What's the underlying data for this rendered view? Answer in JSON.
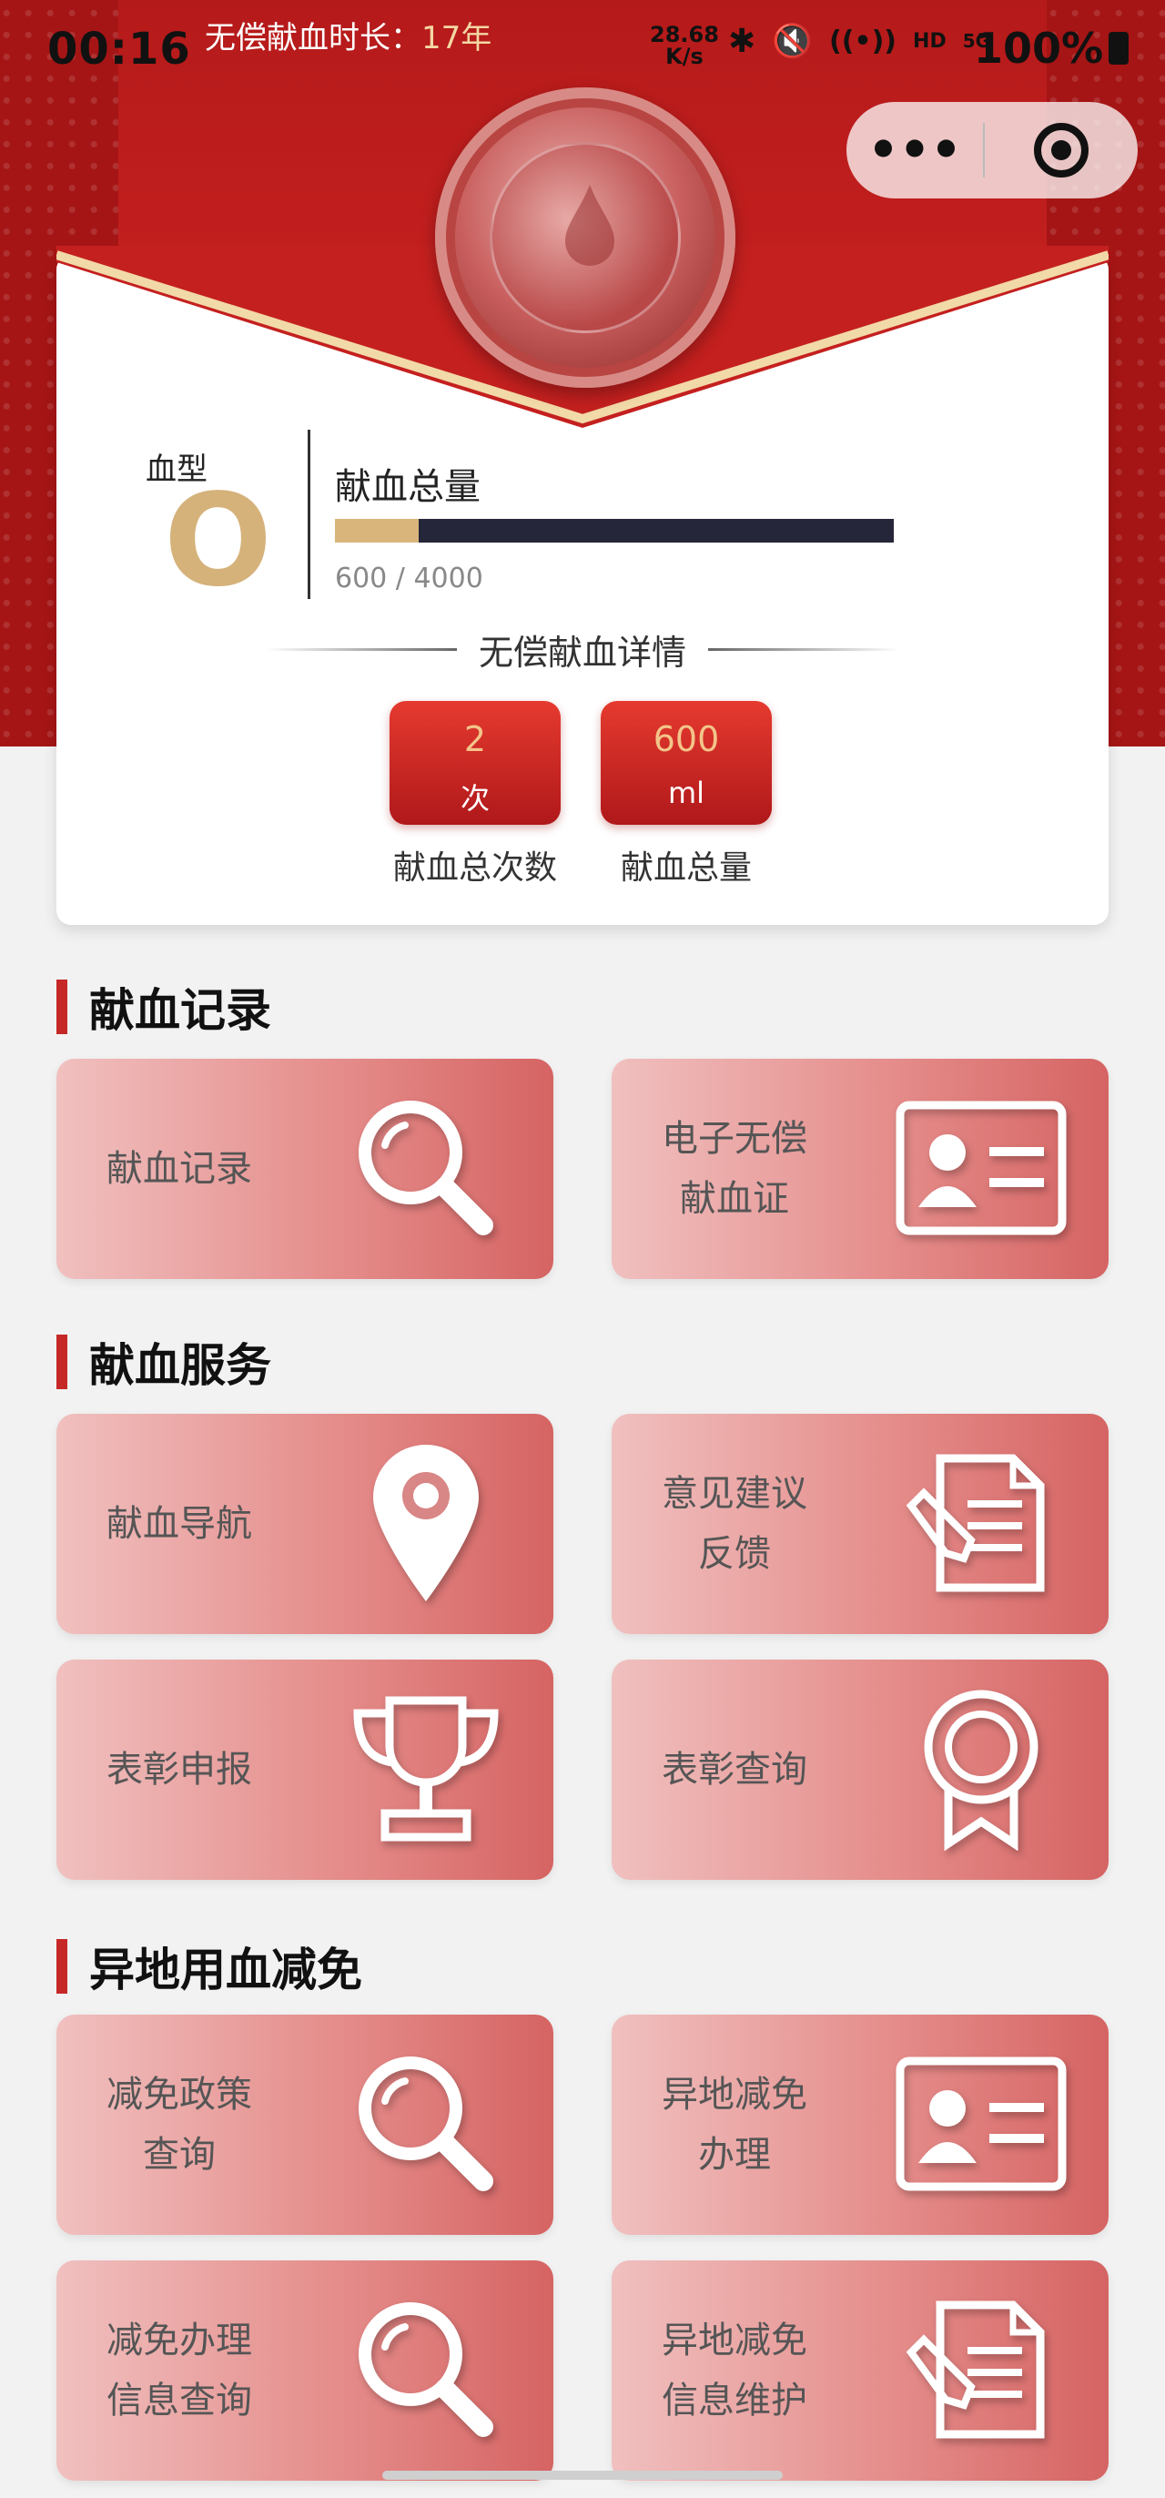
{
  "status_bar": {
    "time": "00:16",
    "notification_prefix": "无偿献血时长：",
    "notification_value": "17年",
    "net_speed_value": "28.68",
    "net_speed_unit": "K/s",
    "network": "HD",
    "signal": "5G",
    "battery": "100%"
  },
  "capsule": {
    "more_label": "•••"
  },
  "profile": {
    "blood_type_label": "血型",
    "blood_type_value": "O",
    "total_label": "献血总量",
    "progress_text": "600 / 4000",
    "progress_fraction": 0.15,
    "details_title": "无偿献血详情",
    "stats": [
      {
        "value": "2",
        "unit": "次",
        "caption": "献血总次数"
      },
      {
        "value": "600",
        "unit": "ml",
        "caption": "献血总量"
      }
    ]
  },
  "sections": [
    {
      "title": "献血记录",
      "tiles": [
        {
          "label": "献血记录",
          "icon": "magnifier-icon"
        },
        {
          "label": "电子无偿\n献血证",
          "icon": "id-card-icon"
        }
      ]
    },
    {
      "title": "献血服务",
      "tiles": [
        {
          "label": "献血导航",
          "icon": "map-pin-icon"
        },
        {
          "label": "意见建议\n反馈",
          "icon": "document-pen-icon"
        },
        {
          "label": "表彰申报",
          "icon": "trophy-icon"
        },
        {
          "label": "表彰查询",
          "icon": "award-ribbon-icon"
        }
      ]
    },
    {
      "title": "异地用血减免",
      "tiles": [
        {
          "label": "减免政策\n查询",
          "icon": "magnifier-icon"
        },
        {
          "label": "异地减免\n办理",
          "icon": "id-card-icon"
        },
        {
          "label": "减免办理\n信息查询",
          "icon": "magnifier-icon"
        },
        {
          "label": "异地减免\n信息维护",
          "icon": "document-pen-icon"
        }
      ]
    }
  ],
  "colors": {
    "primary_red": "#c4201f",
    "gold": "#d5b27a",
    "tile_gradient_start": "#f0c0bf",
    "tile_gradient_end": "#d56463"
  }
}
